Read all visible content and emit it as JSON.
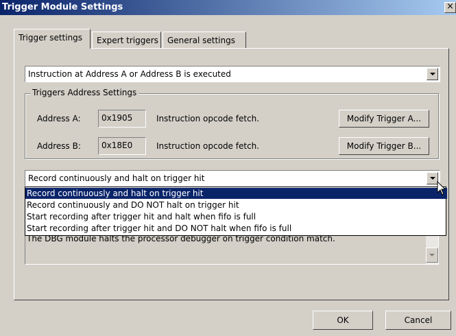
{
  "window": {
    "title": "Trigger Module Settings",
    "close_glyph": "×"
  },
  "tabs": [
    {
      "label": "Trigger settings"
    },
    {
      "label": "Expert triggers"
    },
    {
      "label": "General settings"
    }
  ],
  "trigger_condition": {
    "value": "Instruction at Address A or Address B is executed"
  },
  "address_group": {
    "title": "Triggers Address Settings",
    "address_a": {
      "label": "Address A:",
      "value": "0x1905",
      "description": "Instruction opcode fetch.",
      "button": "Modify Trigger A..."
    },
    "address_b": {
      "label": "Address B:",
      "value": "0x18E0",
      "description": "Instruction opcode fetch.",
      "button": "Modify Trigger B..."
    }
  },
  "record_mode": {
    "value": "Record continuously and halt on trigger hit",
    "options": [
      "Record continuously and halt on trigger hit",
      "Record continuously and DO NOT halt on trigger hit",
      "Start recording after trigger hit and halt when fifo is full",
      "Start recording after trigger hit and DO NOT halt when fifo is full"
    ],
    "selected_index": 0
  },
  "description": {
    "text": "The DBG module halts the processor debugger on trigger condition match."
  },
  "buttons": {
    "ok": "OK",
    "cancel": "Cancel"
  },
  "colors": {
    "titlebar_start": "#0a246a",
    "titlebar_end": "#a6caf0",
    "selection": "#0a246a",
    "face": "#d4d0c8"
  }
}
